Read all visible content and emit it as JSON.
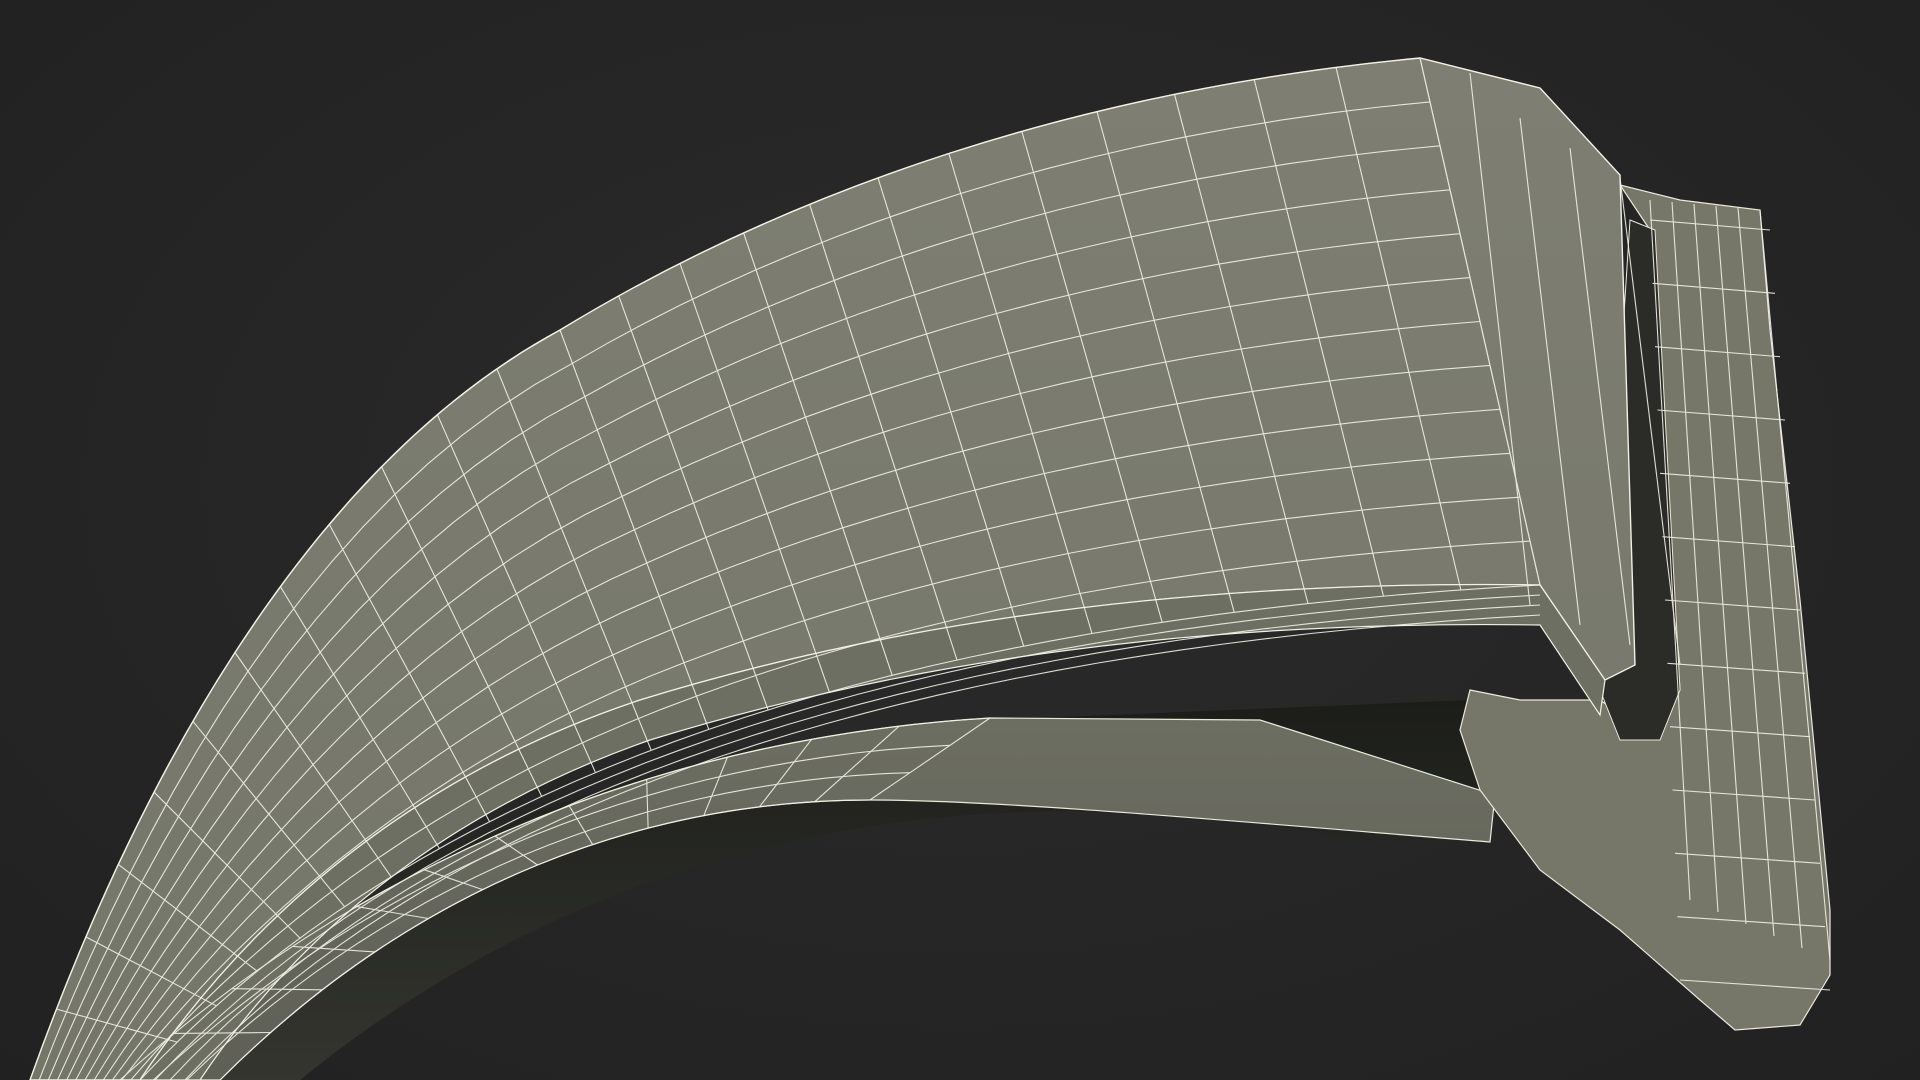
{
  "scene": {
    "subject_icon": "wireframe-mesh-icon",
    "render_mode": "smooth-shaded-with-wireframe",
    "background_color": "#262626",
    "surface_color": "#7a7b6e",
    "inner_surface_color": "#2f302b",
    "wire_color": "#f1f1e6"
  }
}
